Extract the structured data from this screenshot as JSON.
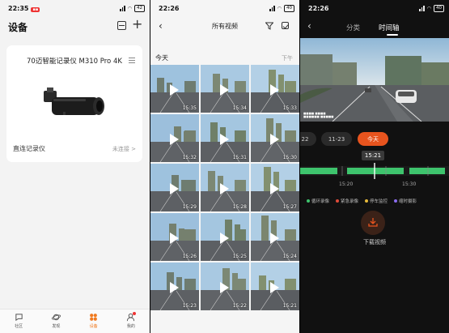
{
  "panel1": {
    "status": {
      "time": "22:35",
      "badge": "",
      "battery": "42"
    },
    "title": "设备",
    "device": {
      "name": "70迈智能记录仪 M310 Pro 4K",
      "connect_label": "直连记录仪",
      "connect_status": "未连接 >"
    },
    "tabs": [
      {
        "label": "社区",
        "icon": "community-icon"
      },
      {
        "label": "发现",
        "icon": "planet-icon"
      },
      {
        "label": "设备",
        "icon": "device-grid-icon",
        "active": true
      },
      {
        "label": "我的",
        "icon": "profile-icon"
      }
    ]
  },
  "panel2": {
    "status": {
      "time": "22:26",
      "battery": "40"
    },
    "title": "所有视频",
    "date_label": "今天",
    "period_label": "下午",
    "timestamps": [
      "15:35",
      "15:34",
      "15:33",
      "15:32",
      "15:31",
      "15:30",
      "15:29",
      "15:28",
      "15:27",
      "15:26",
      "15:25",
      "15:24",
      "15:23",
      "15:22",
      "15:21"
    ]
  },
  "panel3": {
    "status": {
      "time": "22:26",
      "battery": "40"
    },
    "tabs": [
      "分类",
      "时间轴"
    ],
    "active_tab": "时间轴",
    "chips": [
      "22",
      "11-23",
      "今天"
    ],
    "active_chip": "今天",
    "current_time": "15:21",
    "timeline_labels": [
      "15:20",
      "15:30"
    ],
    "legend": [
      {
        "label": "循环录像",
        "color": "#3ec46d"
      },
      {
        "label": "紧急录像",
        "color": "#e04b3a"
      },
      {
        "label": "停车监控",
        "color": "#e6b93a"
      },
      {
        "label": "缩时摄影",
        "color": "#8a6cf0"
      }
    ],
    "download_label": "下载视频",
    "accent": "#e8541e"
  }
}
